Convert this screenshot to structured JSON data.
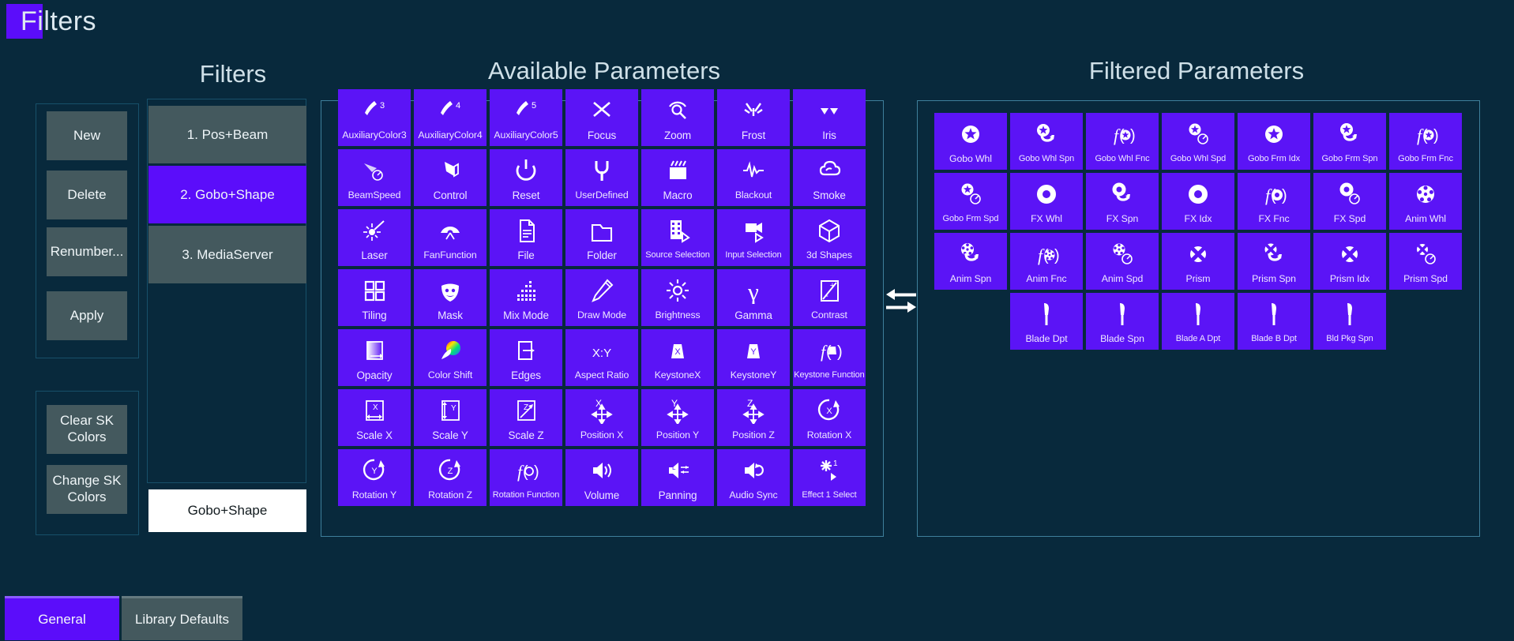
{
  "window": {
    "title": "Filters",
    "chip_color": "#5b0dfa"
  },
  "theme": {
    "background": "#08293c",
    "tile_purple": "#5b14f6",
    "accent_purple": "#5b0dfa",
    "button_gray": "#44595e",
    "panel_border": "#3e7f9b",
    "text_light": "#cfe0e8"
  },
  "headings": {
    "filters": "Filters",
    "available": "Available Parameters",
    "filtered": "Filtered Parameters"
  },
  "actions": {
    "new": "New",
    "delete": "Delete",
    "renumber": "Renumber...",
    "apply": "Apply",
    "clear_sk": "Clear SK Colors",
    "change_sk": "Change SK Colors"
  },
  "filters_list": {
    "items": [
      {
        "label": "1. Pos+Beam",
        "selected": false
      },
      {
        "label": "2. Gobo+Shape",
        "selected": true
      },
      {
        "label": "3. MediaServer",
        "selected": false
      }
    ],
    "name_field_value": "Gobo+Shape"
  },
  "transfer": {
    "icon": "left-right-arrows"
  },
  "available_parameters": [
    {
      "label": "AuxiliaryColor3",
      "icon": "brush-3-icon",
      "size": "small"
    },
    {
      "label": "AuxiliaryColor4",
      "icon": "brush-4-icon",
      "size": "small"
    },
    {
      "label": "AuxiliaryColor5",
      "icon": "brush-5-icon",
      "size": "small"
    },
    {
      "label": "Focus",
      "icon": "focus-icon"
    },
    {
      "label": "Zoom",
      "icon": "zoom-icon"
    },
    {
      "label": "Frost",
      "icon": "frost-icon"
    },
    {
      "label": "Iris",
      "icon": "iris-icon"
    },
    {
      "label": "BeamSpeed",
      "icon": "beam-speed-icon",
      "size": "small"
    },
    {
      "label": "Control",
      "icon": "control-icon"
    },
    {
      "label": "Reset",
      "icon": "power-reset-icon"
    },
    {
      "label": "UserDefined",
      "icon": "wrench-icon",
      "size": "small"
    },
    {
      "label": "Macro",
      "icon": "clapperboard-icon"
    },
    {
      "label": "Blackout",
      "icon": "waveform-icon",
      "size": "small"
    },
    {
      "label": "Smoke",
      "icon": "smoke-cloud-icon"
    },
    {
      "label": "Laser",
      "icon": "laser-icon"
    },
    {
      "label": "FanFunction",
      "icon": "fan-icon",
      "size": "small"
    },
    {
      "label": "File",
      "icon": "file-icon"
    },
    {
      "label": "Folder",
      "icon": "folder-icon"
    },
    {
      "label": "Source Selection",
      "icon": "film-strip-select-icon",
      "size": "tiny"
    },
    {
      "label": "Input Selection",
      "icon": "camera-select-icon",
      "size": "tiny"
    },
    {
      "label": "3d Shapes",
      "icon": "cube-icon",
      "size": "small"
    },
    {
      "label": "Tiling",
      "icon": "tiling-grid-icon"
    },
    {
      "label": "Mask",
      "icon": "theater-mask-icon"
    },
    {
      "label": "Mix Mode",
      "icon": "mix-bars-icon"
    },
    {
      "label": "Draw Mode",
      "icon": "pencil-icon",
      "size": "small"
    },
    {
      "label": "Brightness",
      "icon": "brightness-sun-icon",
      "size": "small"
    },
    {
      "label": "Gamma",
      "icon": "gamma-glyph-icon"
    },
    {
      "label": "Contrast",
      "icon": "contrast-icon",
      "size": "small"
    },
    {
      "label": "Opacity",
      "icon": "opacity-gradient-icon"
    },
    {
      "label": "Color Shift",
      "icon": "color-wheel-icon",
      "size": "small"
    },
    {
      "label": "Edges",
      "icon": "edges-icon"
    },
    {
      "label": "Aspect Ratio",
      "icon": "x-y-ratio-icon",
      "size": "small"
    },
    {
      "label": "KeystoneX",
      "icon": "keystone-x-icon",
      "size": "small"
    },
    {
      "label": "KeystoneY",
      "icon": "keystone-y-icon",
      "size": "small"
    },
    {
      "label": "Keystone Function",
      "icon": "keystone-function-icon",
      "size": "tiny"
    },
    {
      "label": "Scale X",
      "icon": "scale-x-icon"
    },
    {
      "label": "Scale Y",
      "icon": "scale-y-icon"
    },
    {
      "label": "Scale Z",
      "icon": "scale-z-icon"
    },
    {
      "label": "Position X",
      "icon": "position-x-icon",
      "size": "small"
    },
    {
      "label": "Position Y",
      "icon": "position-y-icon",
      "size": "small"
    },
    {
      "label": "Position Z",
      "icon": "position-z-icon",
      "size": "small"
    },
    {
      "label": "Rotation X",
      "icon": "rotation-x-icon",
      "size": "small"
    },
    {
      "label": "Rotation Y",
      "icon": "rotation-y-icon",
      "size": "small"
    },
    {
      "label": "Rotation Z",
      "icon": "rotation-z-icon",
      "size": "small"
    },
    {
      "label": "Rotation Function",
      "icon": "rotation-function-icon",
      "size": "tiny"
    },
    {
      "label": "Volume",
      "icon": "volume-icon"
    },
    {
      "label": "Panning",
      "icon": "panning-lr-icon"
    },
    {
      "label": "Audio Sync",
      "icon": "audio-sync-icon",
      "size": "small"
    },
    {
      "label": "Effect 1 Select",
      "icon": "effect-select-icon",
      "size": "tiny"
    }
  ],
  "filtered_parameters": [
    {
      "label": "Gobo Whl",
      "icon": "gobo-wheel-icon",
      "size": "small"
    },
    {
      "label": "Gobo Whl Spn",
      "icon": "gobo-wheel-spin-icon",
      "size": "tiny"
    },
    {
      "label": "Gobo Whl Fnc",
      "icon": "gobo-wheel-function-icon",
      "size": "tiny"
    },
    {
      "label": "Gobo Whl Spd",
      "icon": "gobo-wheel-speed-icon",
      "size": "tiny"
    },
    {
      "label": "Gobo Frm Idx",
      "icon": "gobo-frame-index-icon",
      "size": "tiny"
    },
    {
      "label": "Gobo Frm Spn",
      "icon": "gobo-frame-spin-icon",
      "size": "tiny"
    },
    {
      "label": "Gobo Frm Fnc",
      "icon": "gobo-frame-function-icon",
      "size": "tiny"
    },
    {
      "label": "Gobo Frm Spd",
      "icon": "gobo-frame-speed-icon",
      "size": "tiny"
    },
    {
      "label": "FX Whl",
      "icon": "fx-wheel-icon",
      "size": "small"
    },
    {
      "label": "FX Spn",
      "icon": "fx-spin-icon",
      "size": "small"
    },
    {
      "label": "FX Idx",
      "icon": "fx-index-icon",
      "size": "small"
    },
    {
      "label": "FX Fnc",
      "icon": "fx-function-icon",
      "size": "small"
    },
    {
      "label": "FX Spd",
      "icon": "fx-speed-icon",
      "size": "small"
    },
    {
      "label": "Anim Whl",
      "icon": "anim-wheel-icon",
      "size": "small"
    },
    {
      "label": "Anim Spn",
      "icon": "anim-spin-icon",
      "size": "small"
    },
    {
      "label": "Anim Fnc",
      "icon": "anim-function-icon",
      "size": "small"
    },
    {
      "label": "Anim Spd",
      "icon": "anim-speed-icon",
      "size": "small"
    },
    {
      "label": "Prism",
      "icon": "prism-icon",
      "size": "small"
    },
    {
      "label": "Prism Spn",
      "icon": "prism-spin-icon",
      "size": "small"
    },
    {
      "label": "Prism Idx",
      "icon": "prism-index-icon",
      "size": "small"
    },
    {
      "label": "Prism Spd",
      "icon": "prism-speed-icon",
      "size": "small"
    },
    {
      "label": "Blade Dpt",
      "icon": "blade-depth-icon",
      "size": "small",
      "offset": true
    },
    {
      "label": "Blade Spn",
      "icon": "blade-spin-icon",
      "size": "small"
    },
    {
      "label": "Blade A Dpt",
      "icon": "blade-a-depth-icon",
      "size": "tiny"
    },
    {
      "label": "Blade B Dpt",
      "icon": "blade-b-depth-icon",
      "size": "tiny"
    },
    {
      "label": "Bld Pkg Spn",
      "icon": "blade-package-spin-icon",
      "size": "tiny"
    }
  ],
  "tabs": [
    {
      "label": "General",
      "active": true
    },
    {
      "label": "Library Defaults",
      "active": false
    }
  ]
}
